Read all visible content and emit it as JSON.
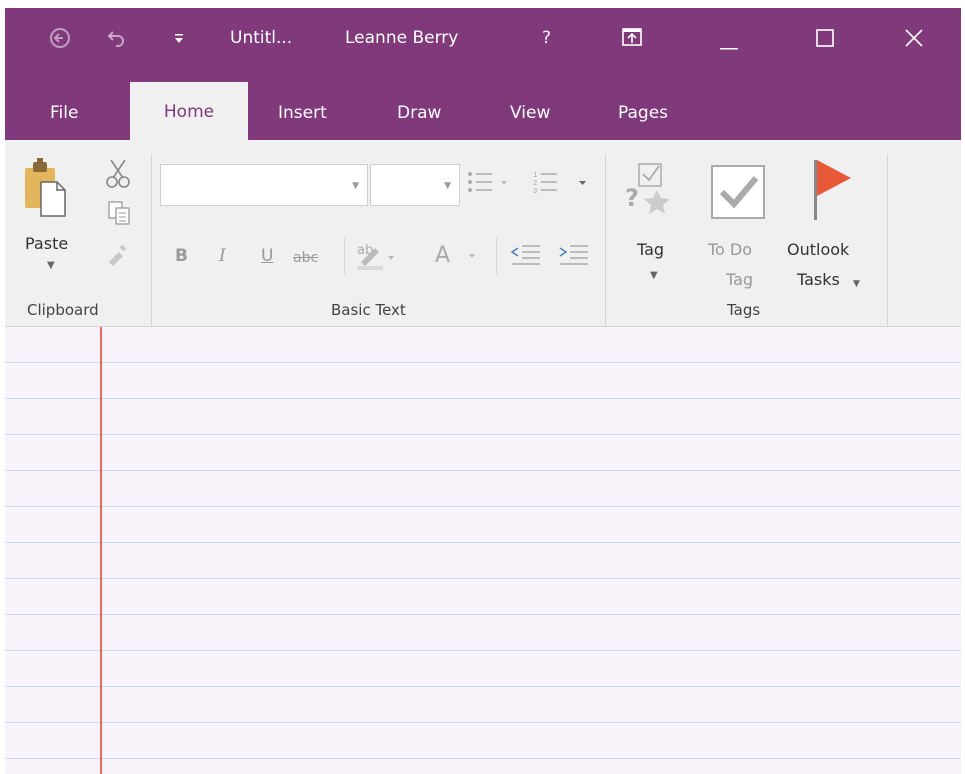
{
  "titlebar": {
    "back_icon": "back-circle-icon",
    "undo_icon": "undo-icon",
    "qat_icon": "customize-quick-access-icon",
    "doc_title": "Untitl...",
    "user_name": "Leanne Berry",
    "help_label": "?",
    "ribbon_display_icon": "ribbon-display-options-icon",
    "minimize_icon": "minimize-icon",
    "maximize_icon": "maximize-icon",
    "close_icon": "close-icon"
  },
  "tabs": [
    "File",
    "Home",
    "Insert",
    "Draw",
    "View",
    "Pages"
  ],
  "active_tab": "Home",
  "ribbon": {
    "clipboard": {
      "paste_label": "Paste",
      "group_label": "Clipboard"
    },
    "basic_text": {
      "font_name": "",
      "font_size": "",
      "bold": "B",
      "italic": "I",
      "underline": "U",
      "strike": "abc",
      "highlight": "ab",
      "font_color": "A",
      "group_label": "Basic Text"
    },
    "tags": {
      "tag_label": "Tag",
      "todo_label_1": "To Do",
      "todo_label_2": "Tag",
      "outlook_label_1": "Outlook",
      "outlook_label_2": "Tasks",
      "group_label": "Tags"
    }
  },
  "colors": {
    "accent": "#80397b",
    "ribbon_bg": "#f0f0f0",
    "page_bg": "#f8f2fa",
    "rule_line": "#c7def0",
    "margin_line": "#ec6a61",
    "flag": "#e8593a"
  }
}
